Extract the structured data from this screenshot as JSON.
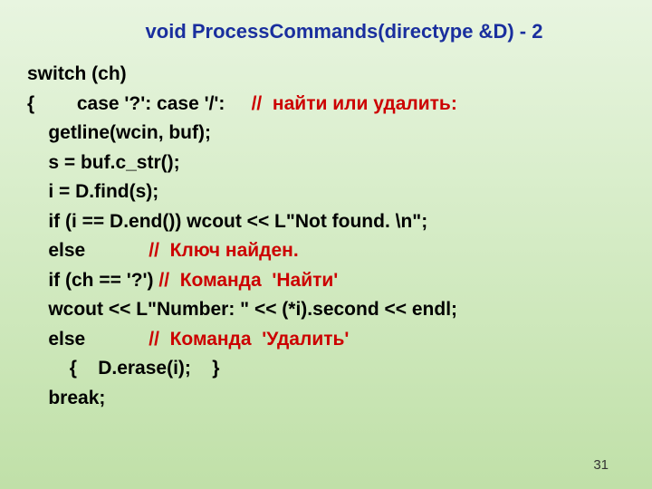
{
  "title": "void ProcessCommands(directype  &D) - 2",
  "lines": [
    {
      "indent": 0,
      "segments": [
        {
          "text": "switch (ch)",
          "cls": "black"
        }
      ]
    },
    {
      "indent": 0,
      "segments": [
        {
          "text": "{        case '?': case '/':     ",
          "cls": "black"
        },
        {
          "text": "//  найти или удалить:",
          "cls": "red"
        }
      ]
    },
    {
      "indent": 1,
      "segments": [
        {
          "text": "getline(wcin, buf);",
          "cls": "black"
        }
      ]
    },
    {
      "indent": 1,
      "segments": [
        {
          "text": "s = buf.c_str();",
          "cls": "black"
        }
      ]
    },
    {
      "indent": 1,
      "segments": [
        {
          "text": "i = D.find(s);",
          "cls": "black"
        }
      ]
    },
    {
      "indent": 1,
      "segments": [
        {
          "text": "if (i == D.end()) wcout << L\"Not found. \\n\";",
          "cls": "black"
        }
      ]
    },
    {
      "indent": 1,
      "segments": [
        {
          "text": "else            ",
          "cls": "black"
        },
        {
          "text": "//  Ключ найден.",
          "cls": "red"
        }
      ]
    },
    {
      "indent": 1,
      "segments": [
        {
          "text": "if (ch == '?') ",
          "cls": "black"
        },
        {
          "text": "//  Команда  'Найти'",
          "cls": "red"
        }
      ]
    },
    {
      "indent": 1,
      "segments": [
        {
          "text": "wcout << L\"Number: \" << (*i).second << endl;",
          "cls": "black"
        }
      ]
    },
    {
      "indent": 1,
      "segments": [
        {
          "text": "else            ",
          "cls": "black"
        },
        {
          "text": "//  Команда  'Удалить'",
          "cls": "red"
        }
      ]
    },
    {
      "indent": 2,
      "segments": [
        {
          "text": "{    D.erase(i);    }",
          "cls": "black"
        }
      ]
    },
    {
      "indent": 1,
      "segments": [
        {
          "text": "break;",
          "cls": "black"
        }
      ]
    }
  ],
  "page_number": "31"
}
